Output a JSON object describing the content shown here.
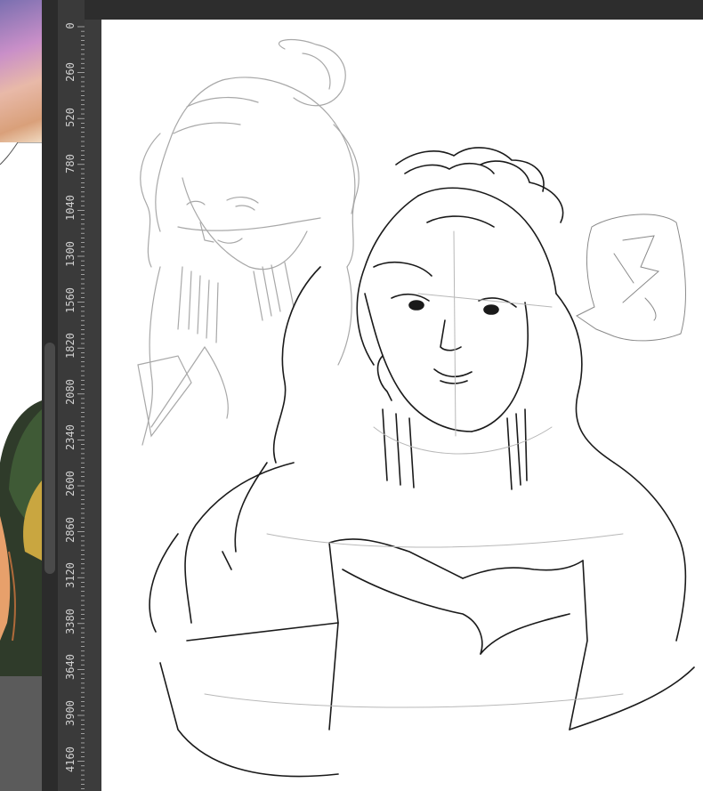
{
  "ruler": {
    "labels": [
      "0",
      "260",
      "520",
      "780",
      "1040",
      "1300",
      "1560",
      "1820",
      "2080",
      "2340",
      "2600",
      "2860",
      "3120",
      "3380",
      "3640",
      "3900",
      "4160"
    ]
  },
  "colors": {
    "workspace": "#3c3c3c",
    "ruler_bg": "#3a3a3a",
    "ruler_text": "#d0d0d0",
    "canvas": "#ffffff",
    "sketch_dark": "#1a1a1a",
    "sketch_light": "#9a9a9a"
  }
}
